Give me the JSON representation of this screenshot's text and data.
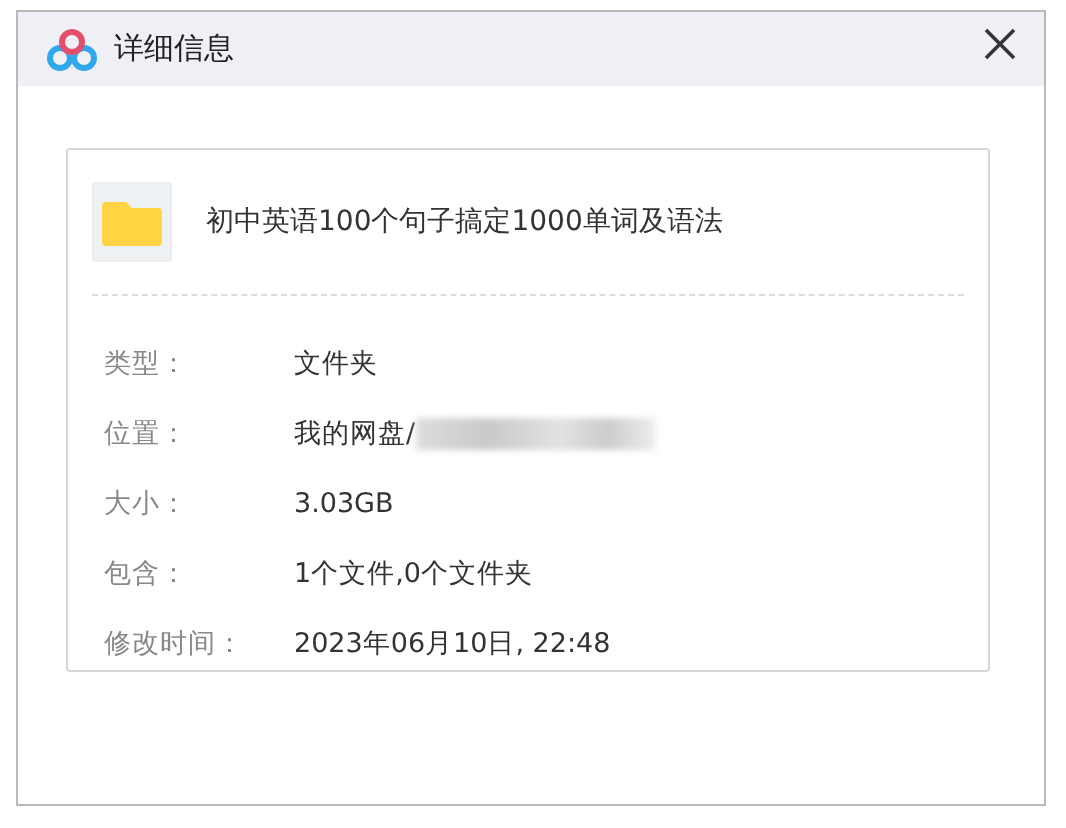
{
  "window": {
    "title": "详细信息"
  },
  "file": {
    "name": "初中英语100个句子搞定1000单词及语法"
  },
  "details": [
    {
      "label": "类型：",
      "value": "文件夹",
      "kind": "text"
    },
    {
      "label": "位置：",
      "value": "我的网盘/",
      "kind": "redacted"
    },
    {
      "label": "大小：",
      "value": "3.03GB",
      "kind": "text"
    },
    {
      "label": "包含：",
      "value": "1个文件,0个文件夹",
      "kind": "text"
    },
    {
      "label": "修改时间：",
      "value": "2023年06月10日, 22:48",
      "kind": "text"
    }
  ]
}
